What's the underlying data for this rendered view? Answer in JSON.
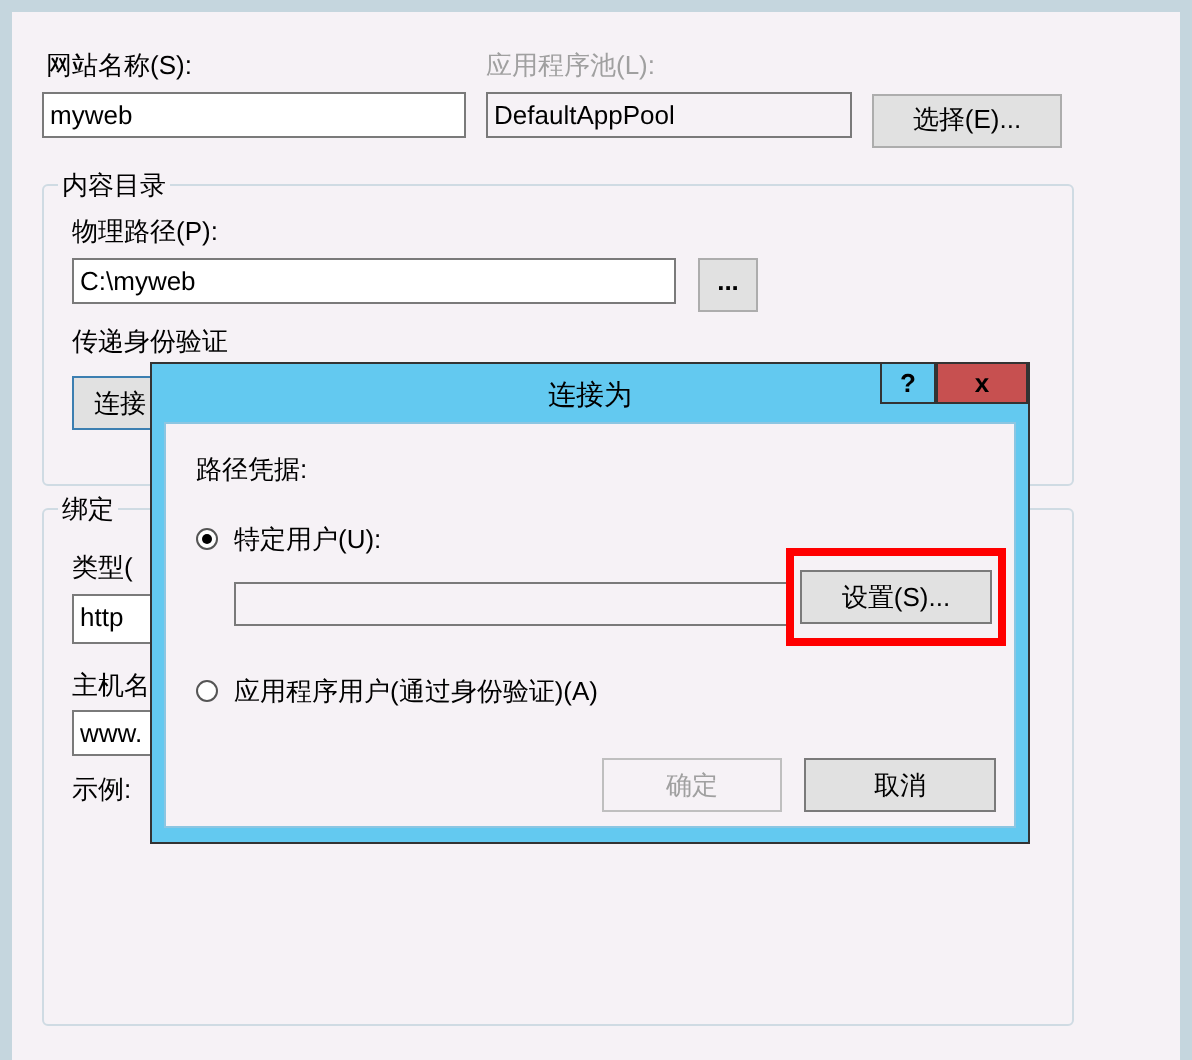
{
  "site_name": {
    "label": "网站名称(S):",
    "value": "myweb"
  },
  "app_pool": {
    "label": "应用程序池(L):",
    "value": "DefaultAppPool",
    "disabled": true
  },
  "select_button": "选择(E)...",
  "content_directory": {
    "title": "内容目录",
    "physical_path": {
      "label": "物理路径(P):",
      "value": "C:\\myweb"
    },
    "browse_button": "...",
    "pass_through_label": "传递身份验证",
    "connect_button": "连接"
  },
  "binding": {
    "title": "绑定",
    "type": {
      "label": "类型(",
      "value": "http"
    },
    "host": {
      "label": "主机名",
      "value": "www."
    },
    "example": "示例:"
  },
  "dialog": {
    "title": "连接为",
    "help_button": "?",
    "close_button": "x",
    "section_label": "路径凭据:",
    "options": [
      {
        "label": "特定用户(U):",
        "selected": true
      },
      {
        "label": "应用程序用户(通过身份验证)(A)",
        "selected": false
      }
    ],
    "settings_button": {
      "label": "设置(S)...",
      "highlighted": true
    },
    "ok_button": {
      "label": "确定",
      "disabled": true
    },
    "cancel_button": {
      "label": "取消"
    }
  }
}
